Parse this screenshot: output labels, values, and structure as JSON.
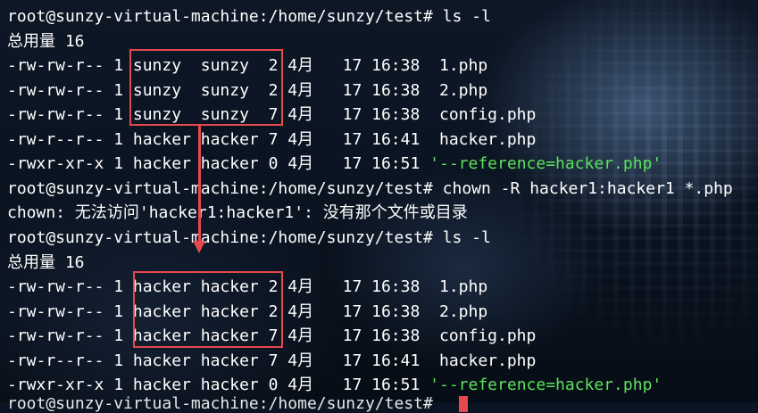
{
  "terminal": {
    "block1": {
      "prompt": "root@sunzy-virtual-machine:/home/sunzy/test# ls -l",
      "total": "总用量 16",
      "rows": [
        "-rw-rw-r-- 1 sunzy  sunzy  2 4月   17 16:38  1.php",
        "-rw-rw-r-- 1 sunzy  sunzy  2 4月   17 16:38  2.php",
        "-rw-rw-r-- 1 sunzy  sunzy  7 4月   17 16:38  config.php",
        "-rw-r--r-- 1 hacker hacker 7 4月   17 16:41  hacker.php"
      ],
      "last_row_prefix": "-rwxr-xr-x 1 hacker hacker 0 4月   17 16:51 ",
      "last_row_file": "'--reference=hacker.php'"
    },
    "chown_command": "root@sunzy-virtual-machine:/home/sunzy/test# chown -R hacker1:hacker1 *.php",
    "chown_error": "chown: 无法访问'hacker1:hacker1': 没有那个文件或目录",
    "block2": {
      "prompt": "root@sunzy-virtual-machine:/home/sunzy/test# ls -l",
      "total": "总用量 16",
      "rows": [
        "-rw-rw-r-- 1 hacker hacker 2 4月   17 16:38  1.php",
        "-rw-rw-r-- 1 hacker hacker 2 4月   17 16:38  2.php",
        "-rw-rw-r-- 1 hacker hacker 7 4月   17 16:38  config.php",
        "-rw-r--r-- 1 hacker hacker 7 4月   17 16:41  hacker.php"
      ],
      "last_row_prefix": "-rwxr-xr-x 1 hacker hacker 0 4月   17 16:51 ",
      "last_row_file": "'--reference=hacker.php'"
    },
    "partial_prompt": "root@sunzy-virtual-machine:/home/sunzy/test# "
  },
  "colors": {
    "text": "#ffffff",
    "highlight_file": "#5be35b",
    "annotation": "#e5484d"
  }
}
